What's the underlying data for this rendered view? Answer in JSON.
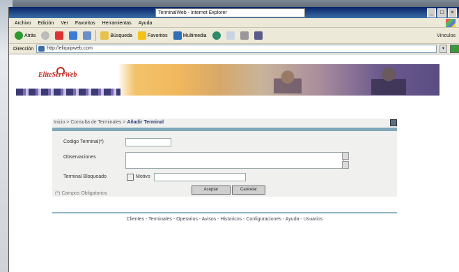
{
  "window": {
    "title": "TerminalWeb - Internet Explorer"
  },
  "menubar": {
    "items": [
      "Archivo",
      "Edición",
      "Ver",
      "Favoritos",
      "Herramientas",
      "Ayuda"
    ]
  },
  "toolbar": {
    "back": "Atrás",
    "search": "Búsqueda",
    "favorites": "Favoritos",
    "multimedia": "Multimedia",
    "links": "Vínculos"
  },
  "address": {
    "label": "Dirección",
    "url": "http://eliquipweb.com"
  },
  "banner": {
    "logo": "EliteServWeb"
  },
  "breadcrumb": {
    "home": "Inicio",
    "sep1": " > ",
    "section": "Consulta de Terminales",
    "sep2": " > ",
    "current": "Añadir Terminal"
  },
  "form": {
    "code_label": "Codigo Terminal(*)",
    "code_value": "",
    "notes_label": "Observaciones",
    "notes_value": "",
    "blocked_label": "Terminal Bloqueado",
    "motive_label": "Motivo",
    "motive_value": "",
    "accept_button": "Aceptar",
    "cancel_button": "Cancelar",
    "required_note": "(*) Campos Obligatorios"
  },
  "footer": {
    "links": "Clientes - Terminales - Operarios - Avisos - Historicos - Configuraciones - Ayuda - Usuarios"
  }
}
